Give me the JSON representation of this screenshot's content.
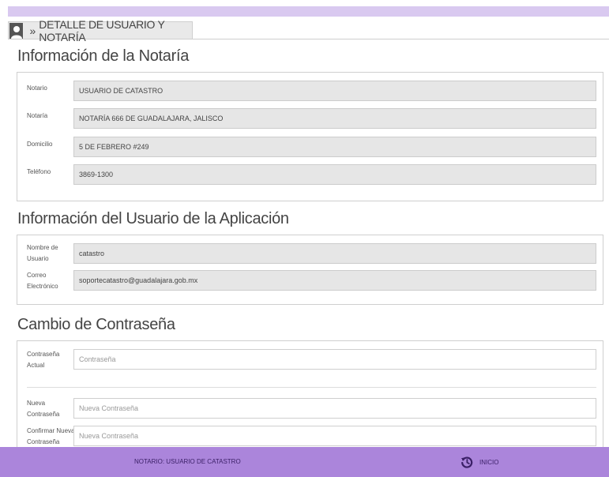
{
  "header": {
    "breadcrumb_separator": "»",
    "breadcrumb_title": "DETALLE DE USUARIO Y NOTARÍA"
  },
  "notaria_section": {
    "title": "Información de la Notaría",
    "fields": [
      {
        "label": "Notario",
        "value": "USUARIO DE CATASTRO"
      },
      {
        "label": "Notaría",
        "value": "NOTARÍA 666 DE GUADALAJARA, JALISCO"
      },
      {
        "label": "Domicilio",
        "value": "5 DE FEBRERO #249"
      },
      {
        "label": "Teléfono",
        "value": "3869-1300"
      }
    ]
  },
  "usuario_section": {
    "title": "Información del Usuario de la Aplicación",
    "fields": [
      {
        "label_line1": "Nombre de",
        "label_line2": "Usuario",
        "value": "catastro"
      },
      {
        "label_line1": "Correo",
        "label_line2": "Electrónico",
        "value": "soportecatastro@guadalajara.gob.mx"
      }
    ]
  },
  "password_section": {
    "title": "Cambio de Contraseña",
    "current": {
      "label_line1": "Contraseña",
      "label_line2": "Actual",
      "placeholder": "Contraseña"
    },
    "new": {
      "label_line1": "Nueva",
      "label_line2": "Contraseña",
      "placeholder": "Nueva Contraseña"
    },
    "confirm": {
      "label_line1": "Confirmar Nueva",
      "label_line2": "Contraseña",
      "placeholder": "Nueva Contraseña"
    }
  },
  "footer": {
    "user_text": "NOTARIO: USUARIO DE CATASTRO",
    "home_label": "INICIO",
    "home_icon": "history-icon"
  },
  "colors": {
    "top_strip": "#d9c9f0",
    "footer_bg": "#ab85db",
    "field_readonly_bg": "#e6e6e6"
  }
}
